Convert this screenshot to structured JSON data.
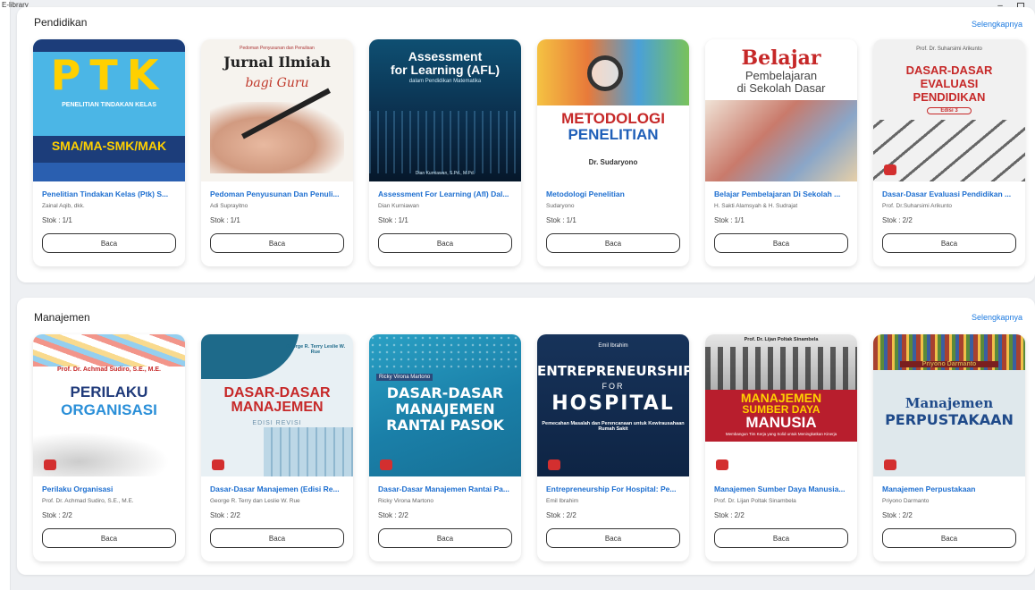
{
  "app": {
    "title": "E-library"
  },
  "window": {
    "minimize": "–",
    "restore": ""
  },
  "sections": [
    {
      "title": "Pendidikan",
      "more_label": "Selengkapnya",
      "books": [
        {
          "title": "Penelitian Tindakan Kelas (Ptk) S...",
          "author": "Zainal Aqib, dkk.",
          "stock": "Stok : 1/1",
          "read_label": "Baca",
          "cover": {
            "style": "ptk",
            "lines": [
              "PTK",
              "PENELITIAN TINDAKAN KELAS",
              "SMA/MA-SMK/MAK"
            ]
          }
        },
        {
          "title": "Pedoman Penyusunan Dan Penuli...",
          "author": "Adi Suprayitno",
          "stock": "Stok : 1/1",
          "read_label": "Baca",
          "cover": {
            "style": "jurnal",
            "lines": [
              "Pedoman Penyusunan dan Penulisan",
              "Jurnal Ilmiah",
              "bagi Guru"
            ]
          }
        },
        {
          "title": "Assessment For Learning (Afl) Dal...",
          "author": "Dian Kurniawan",
          "stock": "Stok : 1/1",
          "read_label": "Baca",
          "cover": {
            "style": "afl",
            "lines": [
              "Assessment",
              "for Learning (AFL)",
              "dalam Pendidikan Matematika",
              "Dian Kurniawan, S.Pd., M.Pd."
            ]
          }
        },
        {
          "title": "Metodologi Penelitian",
          "author": "Sudaryono",
          "stock": "Stok : 1/1",
          "read_label": "Baca",
          "cover": {
            "style": "metod",
            "lines": [
              "METODOLOGI",
              "PENELITIAN",
              "Dr. Sudaryono"
            ]
          }
        },
        {
          "title": "Belajar Pembelajaran Di Sekolah ...",
          "author": "H. Sakti Alamsyah & H. Sudrajat",
          "stock": "Stok : 1/1",
          "read_label": "Baca",
          "cover": {
            "style": "belajar",
            "lines": [
              "Belajar",
              "Pembelajaran",
              "di Sekolah Dasar"
            ]
          }
        },
        {
          "title": "Dasar-Dasar Evaluasi Pendidikan ...",
          "author": "Prof. Dr.Suharsimi Arikunto",
          "stock": "Stok : 2/2",
          "read_label": "Baca",
          "cover": {
            "style": "evaluasi",
            "lines": [
              "Prof. Dr. Suharsimi Arikunto",
              "DASAR-DASAR",
              "EVALUASI",
              "PENDIDIKAN",
              "Edisi 3"
            ]
          }
        }
      ]
    },
    {
      "title": "Manajemen",
      "more_label": "Selengkapnya",
      "books": [
        {
          "title": "Perilaku Organisasi",
          "author": "Prof. Dr. Achmad Sudiro, S.E., M.E.",
          "stock": "Stok : 2/2",
          "read_label": "Baca",
          "cover": {
            "style": "perilaku",
            "lines": [
              "Prof. Dr. Achmad Sudiro, S.E., M.E.",
              "PERILAKU",
              "ORGANISASI"
            ]
          }
        },
        {
          "title": "Dasar-Dasar Manajemen (Edisi Re...",
          "author": "George R. Terry dan Leslie W. Rue",
          "stock": "Stok : 2/2",
          "read_label": "Baca",
          "cover": {
            "style": "dasman",
            "lines": [
              "George R. Terry Leslie W. Rue",
              "DASAR-DASAR",
              "MANAJEMEN",
              "EDISI REVISI"
            ]
          }
        },
        {
          "title": "Dasar-Dasar Manajemen Rantai Pa...",
          "author": "Ricky Virona Martono",
          "stock": "Stok : 2/2",
          "read_label": "Baca",
          "cover": {
            "style": "rantai",
            "lines": [
              "Ricky Virona Martono",
              "DASAR-DASAR",
              "MANAJEMEN",
              "RANTAI PASOK"
            ]
          }
        },
        {
          "title": "Entrepreneurship For Hospital: Pe...",
          "author": "Emil Ibrahim",
          "stock": "Stok : 2/2",
          "read_label": "Baca",
          "cover": {
            "style": "entre",
            "lines": [
              "Emil Ibrahim",
              "ENTREPRENEURSHIP",
              "FOR",
              "HOSPITAL",
              "Pemecahan Masalah dan Perencanaan untuk Kewirausahaan Rumah Sakit"
            ]
          }
        },
        {
          "title": "Manajemen Sumber Daya Manusia...",
          "author": "Prof. Dr. Lijan Poltak Sinambela",
          "stock": "Stok : 2/2",
          "read_label": "Baca",
          "cover": {
            "style": "sdm",
            "lines": [
              "Prof. Dr. Lijan Poltak Sinambela",
              "MANAJEMEN",
              "SUMBER DAYA",
              "MANUSIA",
              "Membangun Tim Kerja yang Solid untuk Meningkatkan Kinerja"
            ]
          }
        },
        {
          "title": "Manajemen Perpustakaan",
          "author": "Priyono Darmanto",
          "stock": "Stok : 2/2",
          "read_label": "Baca",
          "cover": {
            "style": "perpus",
            "lines": [
              "Priyono Darmanto",
              "Manajemen",
              "PERPUSTAKAAN"
            ]
          }
        }
      ]
    }
  ]
}
